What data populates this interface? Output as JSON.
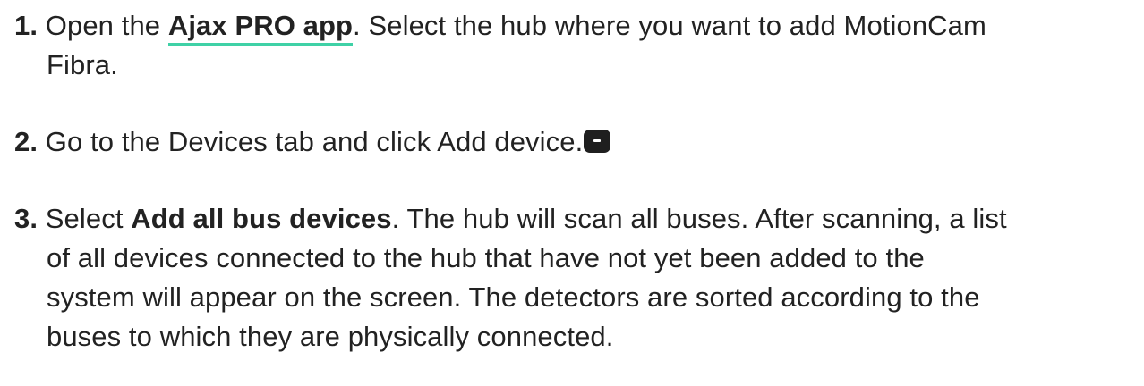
{
  "steps": [
    {
      "number": "1.",
      "before": "Open the ",
      "link": "Ajax PRO app",
      "line1_after": ". Select the hub where you want to add MotionCam",
      "line2": "Fibra."
    },
    {
      "number": "2.",
      "text": "Go to the Devices tab and click Add device.",
      "icon": "minus-icon"
    },
    {
      "number": "3.",
      "before": "Select ",
      "bold": "Add all bus devices",
      "line1_after": ". The hub will scan all buses. After scanning, a list",
      "line2": "of all devices connected to the hub that have not yet been added to the",
      "line3": "system will appear on the screen. The detectors are sorted according to the",
      "line4": "buses to which they are physically connected."
    }
  ],
  "colors": {
    "text": "#222222",
    "link_underline": "#3fd1a6",
    "icon_bg": "#1f1f1f"
  }
}
